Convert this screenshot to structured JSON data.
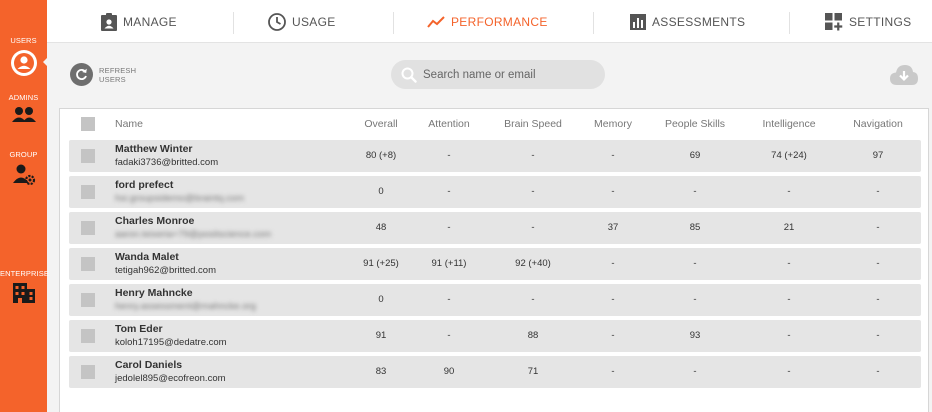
{
  "sidebar": {
    "items": [
      {
        "label": "USERS",
        "icon": "user-circle-icon",
        "active": true
      },
      {
        "label": "ADMINS",
        "icon": "admins-icon"
      },
      {
        "label": "GROUP",
        "icon": "group-settings-icon"
      },
      {
        "label": "ENTERPRISE",
        "icon": "building-icon"
      }
    ]
  },
  "nav": {
    "tabs": [
      {
        "label": "MANAGE",
        "icon": "clipboard-user-icon"
      },
      {
        "label": "USAGE",
        "icon": "clock-icon"
      },
      {
        "label": "PERFORMANCE",
        "icon": "trend-line-icon",
        "active": true
      },
      {
        "label": "ASSESSMENTS",
        "icon": "bar-chart-icon"
      },
      {
        "label": "SETTINGS",
        "icon": "grid-plus-icon"
      }
    ]
  },
  "toolbar": {
    "refresh_label": "REFRESH USERS",
    "search_placeholder": "Search name or email",
    "download_icon": "cloud-download-icon"
  },
  "table": {
    "columns": [
      "Name",
      "Overall",
      "Attention",
      "Brain Speed",
      "Memory",
      "People Skills",
      "Intelligence",
      "Navigation"
    ],
    "rows": [
      {
        "name": "Matthew Winter",
        "email": "fadaki3736@britted.com",
        "email_obscured": false,
        "values": [
          "80 (+8)",
          "-",
          "-",
          "-",
          "69",
          "74 (+24)",
          "97"
        ]
      },
      {
        "name": "ford prefect",
        "email": "hsi.groupsidemo@braintq.com",
        "email_obscured": true,
        "values": [
          "0",
          "-",
          "-",
          "-",
          "-",
          "-",
          "-"
        ]
      },
      {
        "name": "Charles Monroe",
        "email": "aaron.teixeria+79@positscience.com",
        "email_obscured": true,
        "values": [
          "48",
          "-",
          "-",
          "37",
          "85",
          "21",
          "-"
        ]
      },
      {
        "name": "Wanda Malet",
        "email": "tetigah962@britted.com",
        "email_obscured": false,
        "values": [
          "91 (+25)",
          "91 (+11)",
          "92 (+40)",
          "-",
          "-",
          "-",
          "-"
        ]
      },
      {
        "name": "Henry Mahncke",
        "email": "henry.assessment@mahncke.org",
        "email_obscured": true,
        "values": [
          "0",
          "-",
          "-",
          "-",
          "-",
          "-",
          "-"
        ]
      },
      {
        "name": "Tom Eder",
        "email": "koloh17195@dedatre.com",
        "email_obscured": false,
        "values": [
          "91",
          "-",
          "88",
          "-",
          "93",
          "-",
          "-"
        ]
      },
      {
        "name": "Carol Daniels",
        "email": "jedolel895@ecofreon.com",
        "email_obscured": false,
        "values": [
          "83",
          "90",
          "71",
          "-",
          "-",
          "-",
          "-"
        ]
      }
    ]
  },
  "colors": {
    "accent": "#f4632b",
    "row_bg": "#e5e5e5",
    "checkbox": "#c4c4c4"
  }
}
